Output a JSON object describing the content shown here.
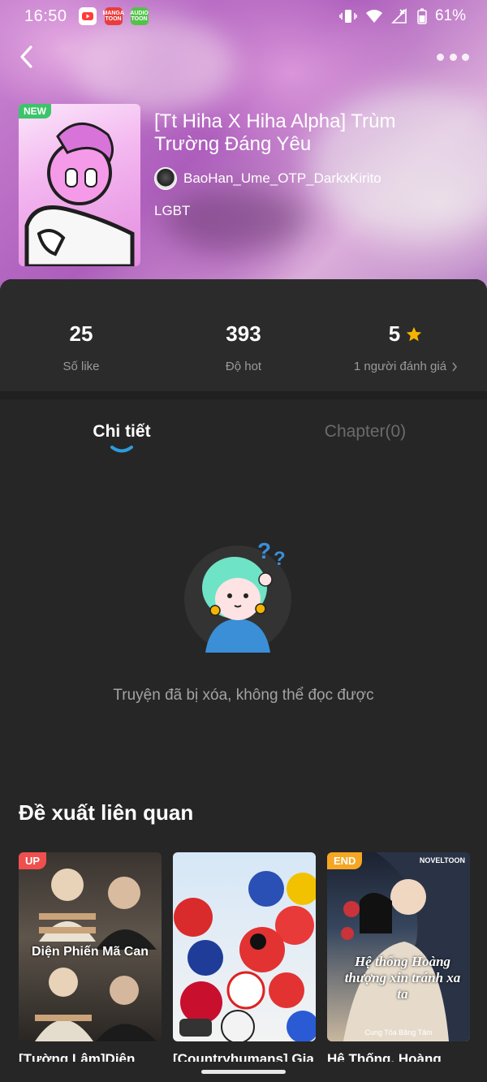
{
  "status_bar": {
    "time": "16:50",
    "apps": [
      "MANGA TOON",
      "AUDIO TOON"
    ],
    "battery": "61%"
  },
  "book": {
    "badge": "NEW",
    "title": "[Tt Hiha X Hiha Alpha] Trùm\nTrường Đáng Yêu",
    "author": "BaoHan_Ume_OTP_DarkxKirito",
    "tag": "LGBT"
  },
  "stats": [
    {
      "value": "25",
      "label": "Số like"
    },
    {
      "value": "393",
      "label": "Độ hot"
    },
    {
      "value": "5",
      "label": "1 người đánh giá"
    }
  ],
  "tabs": [
    {
      "label": "Chi tiết"
    },
    {
      "label": "Chapter(0)"
    }
  ],
  "empty_message": "Truyện đã bị xóa, không thể đọc được",
  "recommend": {
    "title": "Đề xuất liên quan",
    "items": [
      {
        "badge": "UP",
        "cover_text": "Diện Phiến Mã Can",
        "name": "[Tường Lâm]Diện"
      },
      {
        "badge": "",
        "cover_text": "",
        "name": "[Countryhumans] Gia"
      },
      {
        "badge": "END",
        "cover_text": "Hệ thống Hoàng thượng xin tránh xa ta",
        "name": "Hệ Thống, Hoàng"
      }
    ],
    "cover_extra": {
      "noveltoon": "NOVELTOON",
      "author_line": "Cung Tỏa Băng Tâm"
    }
  },
  "colors": {
    "accent": "#2d9cdb",
    "star": "#f5b400",
    "badge_new": "#3cc46a"
  }
}
